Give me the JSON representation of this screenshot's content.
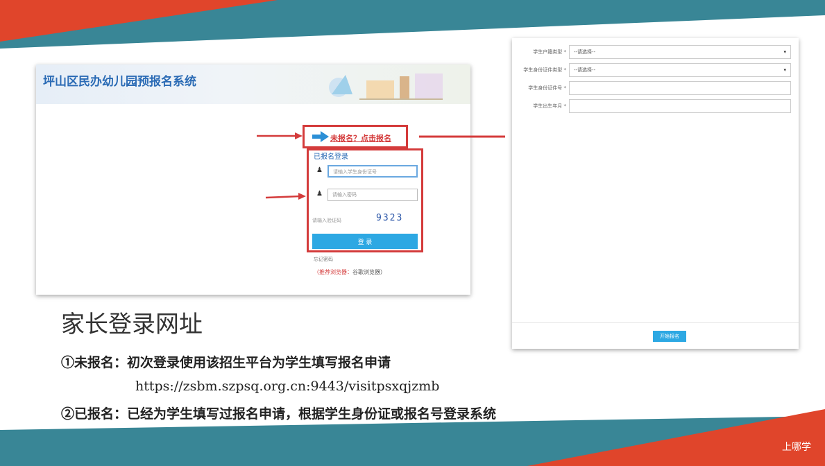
{
  "left_window": {
    "site_title": "坪山区民办幼儿园预报名系统",
    "register_link": "未报名？点击报名",
    "login_title": "已报名登录",
    "id_placeholder": "请输入学生身份证号",
    "password_placeholder": "请输入密码",
    "captcha_placeholder": "请输入验证码",
    "captcha_code": "9323",
    "login_button": "登 录",
    "forgot_password": "忘记密码",
    "browser_hint_recommended": "（推荐浏览器：",
    "browser_hint_rest": "谷歌浏览器）"
  },
  "right_window": {
    "rows": [
      {
        "label": "学生户籍类型 *",
        "value": "--请选择--",
        "type": "select"
      },
      {
        "label": "学生身份证件类型 *",
        "value": "--请选择--",
        "type": "select"
      },
      {
        "label": "学生身份证件号 *",
        "value": "",
        "type": "input"
      },
      {
        "label": "学生出生年月 *",
        "value": "",
        "type": "input"
      }
    ],
    "start_button": "开始报名"
  },
  "slide": {
    "heading": "家长登录网址",
    "item1": "①未报名：初次登录使用该招生平台为学生填写报名申请",
    "url": "https://zsbm.szpsq.org.cn:9443/visitpsxqjzmb",
    "item2": "②已报名：已经为学生填写过报名申请，根据学生身份证或报名号登录系统",
    "watermark": "上哪学"
  },
  "colors": {
    "band_red": "#e0452b",
    "band_teal": "#2e7f90",
    "highlight_red": "#d43b3b",
    "button_blue": "#2da8e3",
    "title_blue": "#2b6bb5"
  }
}
